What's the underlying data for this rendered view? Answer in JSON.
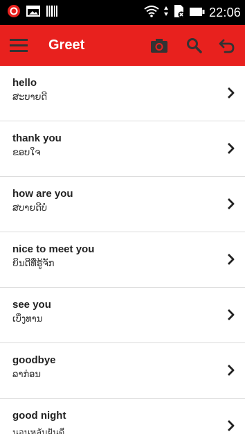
{
  "status_bar": {
    "time": "22:06",
    "left_icons": [
      "app-notification-icon",
      "image-icon",
      "barcode-icon"
    ],
    "right_icons": [
      "wifi-icon",
      "data-arrows-icon",
      "no-sim-icon",
      "battery-icon"
    ]
  },
  "app_bar": {
    "title": "Greet",
    "background": "#e8211e",
    "actions": [
      "camera-icon",
      "search-icon",
      "back-icon"
    ]
  },
  "phrases": [
    {
      "english": "hello",
      "lao": "ສະບາຍດີ"
    },
    {
      "english": "thank you",
      "lao": "ຂອບໃຈ"
    },
    {
      "english": "how are you",
      "lao": "ສບາຍດີບໍ່"
    },
    {
      "english": "nice to meet you",
      "lao": "ຍິນດີທີ່ຮູ້ຈັກ"
    },
    {
      "english": "see you",
      "lao": "ເບິ່ງທານ"
    },
    {
      "english": "goodbye",
      "lao": "ລາກ່ອນ"
    },
    {
      "english": "good night",
      "lao": "นอนหลับฝันดี"
    }
  ]
}
